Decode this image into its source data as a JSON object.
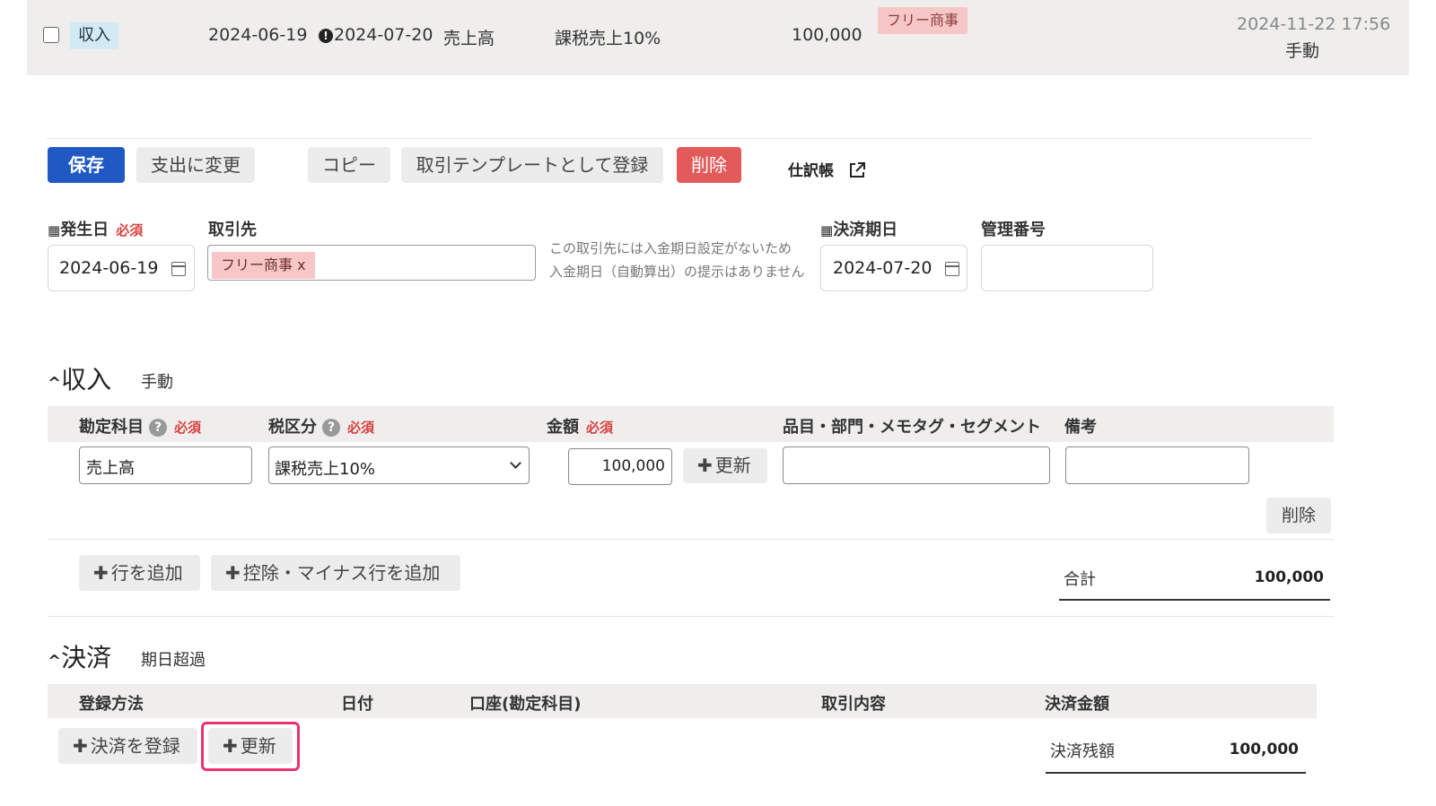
{
  "transaction_row": {
    "type_tag": "収入",
    "issue_date": "2024-06-19",
    "due_date": "2024-07-20",
    "account": "売上高",
    "tax_category": "課税売上10%",
    "amount": "100,000",
    "partner_tag": "フリー商事",
    "updated_at": "2024-11-22 17:56",
    "input_method": "手動"
  },
  "toolbar": {
    "save": "保存",
    "change_to_expense": "支出に変更",
    "copy": "コピー",
    "register_template": "取引テンプレートとして登録",
    "delete": "削除",
    "journal_link": "仕訳帳"
  },
  "form": {
    "issue_date_label": "発生日",
    "required": "必須",
    "issue_date_value": "2024-06-19",
    "partner_label": "取引先",
    "partner_chip": "フリー商事 x",
    "partner_note_line1": "この取引先には入金期日設定がないため",
    "partner_note_line2": "入金期日（自動算出）の提示はありません",
    "due_date_label": "決済期日",
    "due_date_value": "2024-07-20",
    "management_no_label": "管理番号"
  },
  "income_section": {
    "title": "収入",
    "subtitle": "手動",
    "headers": {
      "account": "勘定科目",
      "tax": "税区分",
      "amount": "金額",
      "items": "品目・部門・メモタグ・セグメント",
      "remarks": "備考"
    },
    "row": {
      "account": "売上高",
      "tax": "課税売上10%",
      "amount": "100,000",
      "update_button": "更新",
      "delete_button": "削除"
    },
    "add_row": "行を追加",
    "add_minus_row": "控除・マイナス行を追加",
    "total_label": "合計",
    "total_value": "100,000"
  },
  "settlement_section": {
    "title": "決済",
    "subtitle": "期日超過",
    "headers": {
      "method": "登録方法",
      "date": "日付",
      "account": "口座(勘定科目)",
      "description": "取引内容",
      "amount": "決済金額"
    },
    "register_button": "決済を登録",
    "update_button": "更新",
    "balance_label": "決済残額",
    "balance_value": "100,000"
  },
  "colors": {
    "primary": "#2159c4",
    "danger": "#e35a5a",
    "required": "#d94141",
    "highlight": "#e8336d",
    "partner_tag": "#f7c7c7",
    "income_tag": "#d3e9f4"
  }
}
